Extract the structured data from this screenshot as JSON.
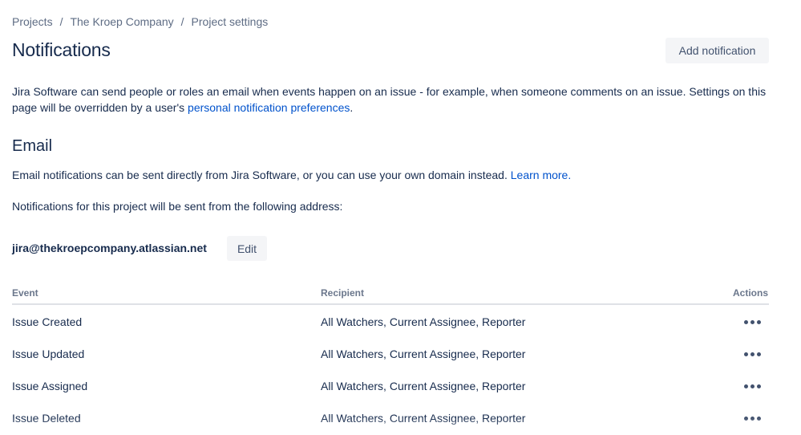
{
  "breadcrumb": {
    "items": [
      "Projects",
      "The Kroep Company",
      "Project settings"
    ],
    "separator": "/"
  },
  "header": {
    "title": "Notifications",
    "add_button_label": "Add notification"
  },
  "intro": {
    "text": "Jira Software can send people or roles an email when events happen on an issue - for example, when someone comments on an issue. Settings on this page will be overridden by a user's ",
    "link_text": "personal notification preferences",
    "suffix": "."
  },
  "email": {
    "section_title": "Email",
    "description": "Email notifications can be sent directly from Jira Software, or you can use your own domain instead. ",
    "learn_more": "Learn more.",
    "address_intro": "Notifications for this project will be sent from the following address:",
    "address": "jira@thekroepcompany.atlassian.net",
    "edit_label": "Edit"
  },
  "table": {
    "headers": {
      "event": "Event",
      "recipient": "Recipient",
      "actions": "Actions"
    },
    "rows": [
      {
        "event": "Issue Created",
        "recipient": "All Watchers, Current Assignee, Reporter"
      },
      {
        "event": "Issue Updated",
        "recipient": "All Watchers, Current Assignee, Reporter"
      },
      {
        "event": "Issue Assigned",
        "recipient": "All Watchers, Current Assignee, Reporter"
      },
      {
        "event": "Issue Deleted",
        "recipient": "All Watchers, Current Assignee, Reporter"
      }
    ],
    "action_icon": "more-horizontal-icon"
  },
  "colors": {
    "link": "#0052cc",
    "text": "#172b4d",
    "muted": "#5e6c84",
    "button_bg": "#f4f5f7"
  }
}
